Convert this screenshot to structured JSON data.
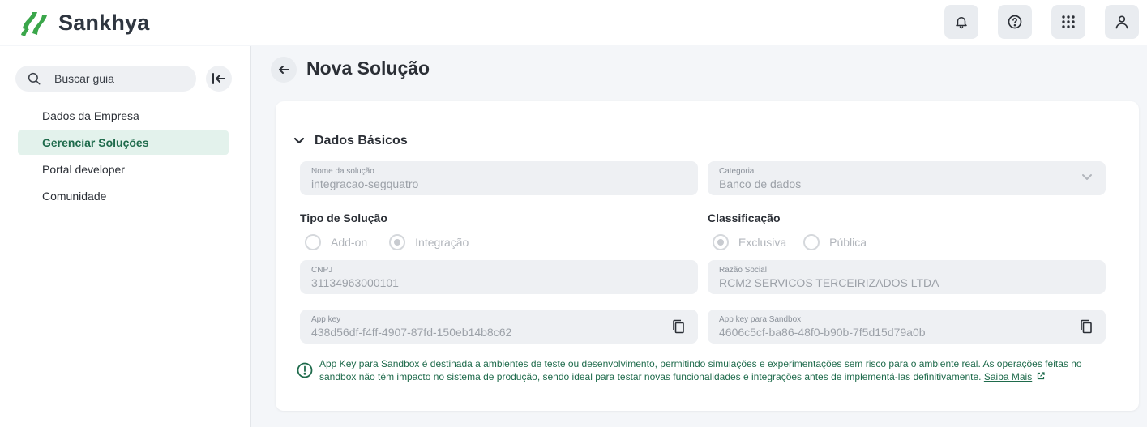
{
  "header": {
    "brand": "Sankhya",
    "brand_color": "#3aa64a",
    "actions": [
      {
        "name": "notifications",
        "icon": "bell-icon"
      },
      {
        "name": "help",
        "icon": "help-circle-icon"
      },
      {
        "name": "apps",
        "icon": "apps-grid-icon"
      },
      {
        "name": "profile",
        "icon": "user-icon"
      }
    ]
  },
  "sidebar": {
    "search_placeholder": "Buscar guia",
    "items": [
      {
        "label": "Dados da Empresa",
        "active": false
      },
      {
        "label": "Gerenciar Soluções",
        "active": true
      },
      {
        "label": "Portal developer",
        "active": false
      },
      {
        "label": "Comunidade",
        "active": false
      }
    ]
  },
  "main": {
    "title": "Nova Solução",
    "section": {
      "title": "Dados Básicos",
      "fields": {
        "nome": {
          "label": "Nome da solução",
          "value": "integracao-segquatro"
        },
        "categoria": {
          "label": "Categoria",
          "value": "Banco de dados"
        },
        "cnpj": {
          "label": "CNPJ",
          "value": "31134963000101"
        },
        "razao": {
          "label": "Razão Social",
          "value": "RCM2 SERVICOS TERCEIRIZADOS LTDA"
        },
        "appkey": {
          "label": "App key",
          "value": "438d56df-f4ff-4907-87fd-150eb14b8c62"
        },
        "appkey_sandbox": {
          "label": "App key para Sandbox",
          "value": "4606c5cf-ba86-48f0-b90b-7f5d15d79a0b"
        }
      },
      "tipo": {
        "label": "Tipo de Solução",
        "options": [
          "Add-on",
          "Integração"
        ],
        "selected": "Integração"
      },
      "classificacao": {
        "label": "Classificação",
        "options": [
          "Exclusiva",
          "Pública"
        ],
        "selected": "Exclusiva"
      },
      "info": {
        "text": "App Key para Sandbox é destinada a ambientes de teste ou desenvolvimento, permitindo simulações e experimentações sem risco para o ambiente real. As operações feitas no sandbox não têm impacto no sistema de produção, sendo ideal para testar novas funcionalidades e integrações antes de implementá-las definitivamente.",
        "link": "Saiba Mais"
      }
    }
  },
  "colors": {
    "accent": "#1f6b4c",
    "active_bg": "#e3f2ec"
  }
}
